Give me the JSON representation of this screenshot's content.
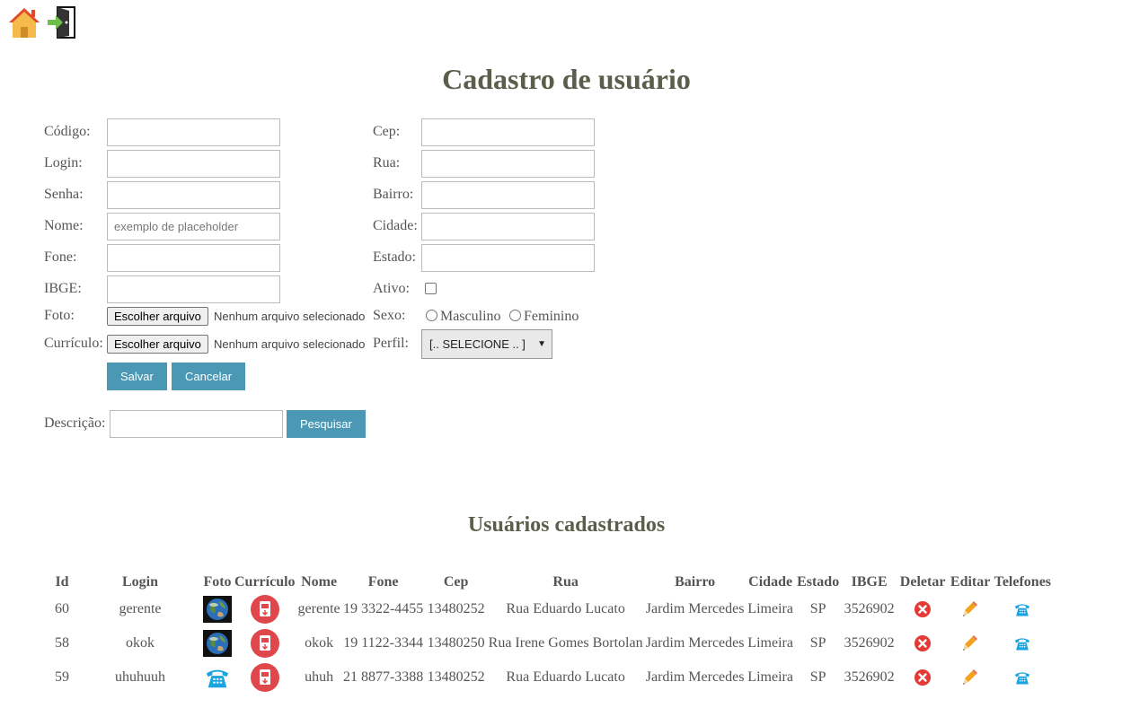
{
  "page": {
    "title": "Cadastro de usuário",
    "list_title": "Usuários cadastrados"
  },
  "nav": {
    "home_icon": "home-icon",
    "logout_icon": "exit-door-icon"
  },
  "form": {
    "labels": {
      "codigo": "Código:",
      "login": "Login:",
      "senha": "Senha:",
      "nome": "Nome:",
      "fone": "Fone:",
      "ibge": "IBGE:",
      "foto": "Foto:",
      "curriculo": "Currículo:",
      "cep": "Cep:",
      "rua": "Rua:",
      "bairro": "Bairro:",
      "cidade": "Cidade:",
      "estado": "Estado:",
      "ativo": "Ativo:",
      "sexo": "Sexo:",
      "perfil": "Perfil:"
    },
    "values": {
      "codigo": "",
      "login": "",
      "senha": "",
      "nome": "",
      "fone": "",
      "ibge": "",
      "cep": "",
      "rua": "",
      "bairro": "",
      "cidade": "",
      "estado": ""
    },
    "nome_placeholder": "exemplo de placeholder",
    "file_button": "Escolher arquivo",
    "file_none": "Nenhum arquivo selecionado",
    "sexo_options": [
      "Masculino",
      "Feminino"
    ],
    "perfil_selected": "[.. SELECIONE .. ]",
    "ativo_checked": false,
    "save_label": "Salvar",
    "cancel_label": "Cancelar"
  },
  "search": {
    "label": "Descrição:",
    "value": "",
    "button": "Pesquisar"
  },
  "table": {
    "headers": [
      "Id",
      "Login",
      "Foto",
      "Currículo",
      "Nome",
      "Fone",
      "Cep",
      "Rua",
      "Bairro",
      "Cidade",
      "Estado",
      "IBGE",
      "Deletar",
      "Editar",
      "Telefones"
    ],
    "rows": [
      {
        "id": "60",
        "login": "gerente",
        "foto": "earth-photo-icon",
        "curriculo": "pdf-download-icon",
        "nome": "gerente",
        "fone": "19 3322-4455",
        "cep": "13480252",
        "rua": "Rua Eduardo Lucato",
        "bairro": "Jardim Mercedes",
        "cidade": "Limeira",
        "estado": "SP",
        "ibge": "3526902"
      },
      {
        "id": "58",
        "login": "okok",
        "foto": "earth-photo-icon",
        "curriculo": "pdf-download-icon",
        "nome": "okok",
        "fone": "19 1122-3344",
        "cep": "13480250",
        "rua": "Rua Irene Gomes Bortolan",
        "bairro": "Jardim Mercedes",
        "cidade": "Limeira",
        "estado": "SP",
        "ibge": "3526902"
      },
      {
        "id": "59",
        "login": "uhuhuuh",
        "foto": "telephone-icon",
        "curriculo": "pdf-download-icon",
        "nome": "uhuh",
        "fone": "21 8877-3388",
        "cep": "13480252",
        "rua": "Rua Eduardo Lucato",
        "bairro": "Jardim Mercedes",
        "cidade": "Limeira",
        "estado": "SP",
        "ibge": "3526902"
      }
    ],
    "action_icons": {
      "delete": "delete-x-icon",
      "edit": "pencil-icon",
      "phones": "telephone-icon"
    }
  },
  "colors": {
    "title": "#5a5e4a",
    "button": "#4a98b4",
    "delete": "#e53935",
    "phone": "#1aa3e0"
  }
}
